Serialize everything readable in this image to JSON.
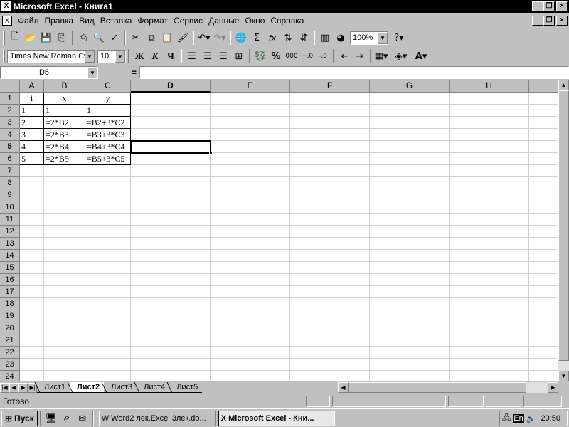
{
  "window": {
    "title": "Microsoft Excel - Книга1"
  },
  "menu": [
    "Файл",
    "Правка",
    "Вид",
    "Вставка",
    "Формат",
    "Сервис",
    "Данные",
    "Окно",
    "Справка"
  ],
  "toolbar": {
    "zoom": "100%",
    "font_name": "Times New Roman Cyr",
    "font_size": "10",
    "bold": "Ж",
    "italic": "К",
    "underline": "Ч",
    "percent": "%",
    "thousands": "000",
    "sum": "Σ",
    "fx": "fx"
  },
  "formula_bar": {
    "cell_ref": "D5",
    "equals": "=",
    "content": ""
  },
  "columns": [
    "A",
    "B",
    "C",
    "D",
    "E",
    "F",
    "G",
    "H"
  ],
  "rows": [
    "1",
    "2",
    "3",
    "4",
    "5",
    "6",
    "7",
    "8",
    "9",
    "10",
    "11",
    "12",
    "13",
    "14",
    "15",
    "16",
    "17",
    "18",
    "19",
    "20",
    "21",
    "22",
    "23",
    "24"
  ],
  "cells": {
    "r1": [
      "i",
      "x",
      "y"
    ],
    "r2": [
      "1",
      "1",
      "1"
    ],
    "r3": [
      "2",
      "=2*B2",
      "=B2+3*C2"
    ],
    "r4": [
      "3",
      "=2*B3",
      "=B3+3*C3"
    ],
    "r5": [
      "4",
      "=2*B4",
      "=B4+3*C4"
    ],
    "r6": [
      "5",
      "=2*B5",
      "=B5+3*C5"
    ]
  },
  "sheets": [
    "Лист1",
    "Лист2",
    "Лист3",
    "Лист4",
    "Лист5"
  ],
  "active_sheet": "Лист2",
  "status": "Готово",
  "taskbar": {
    "start": "Пуск",
    "tasks": [
      "Word2 лек.Excel 3лек.do...",
      "Microsoft Excel - Кни..."
    ],
    "lang": "En",
    "clock": "20:50"
  }
}
